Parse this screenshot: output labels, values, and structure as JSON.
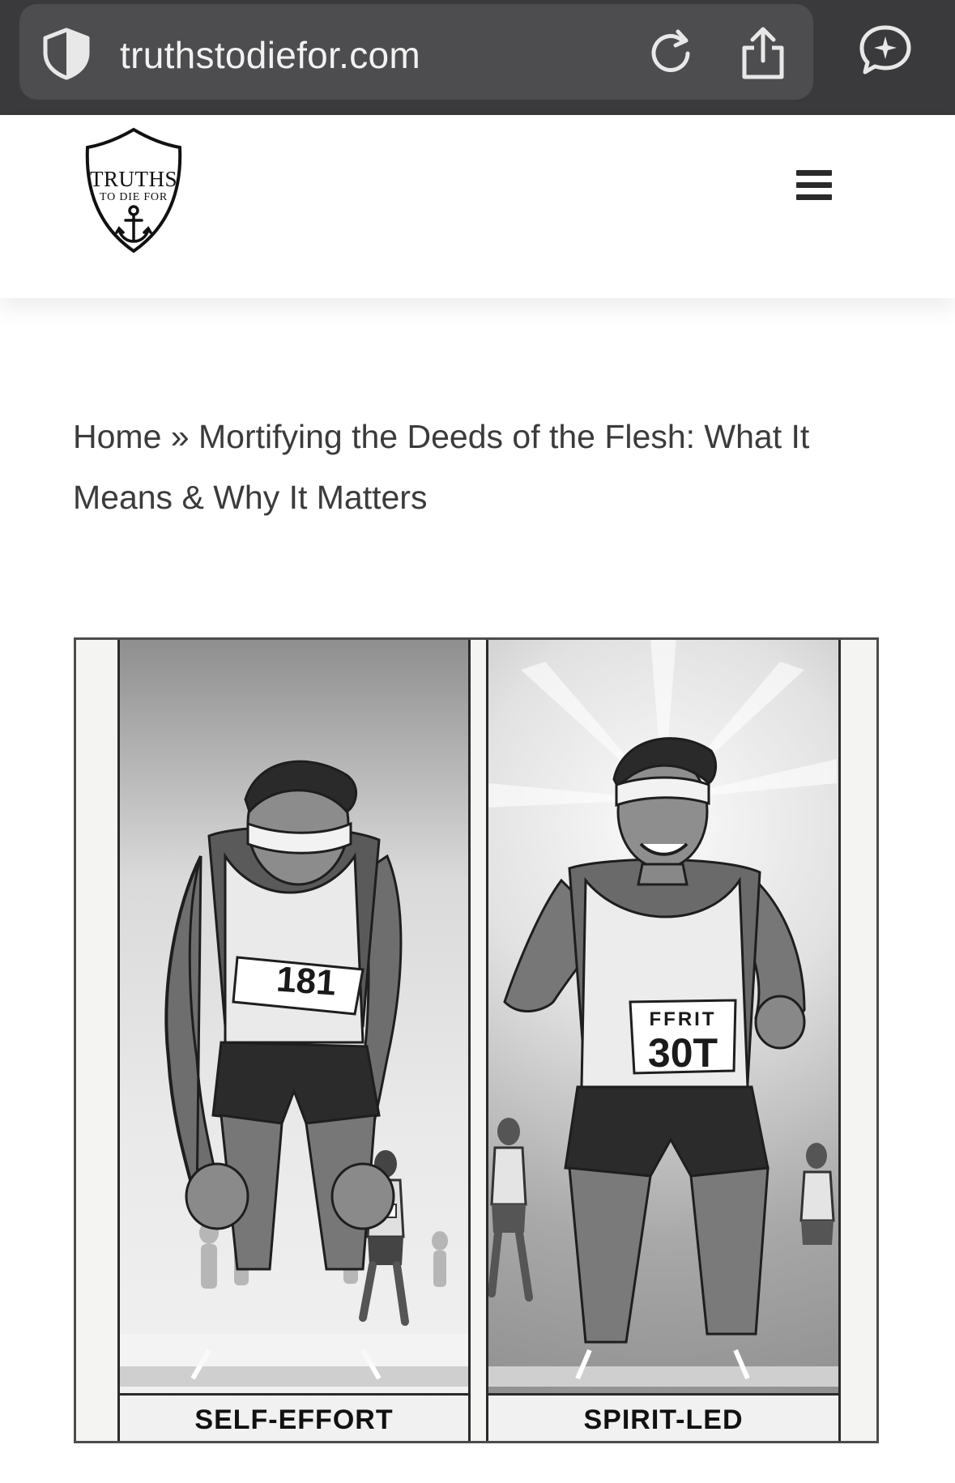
{
  "browser": {
    "url": "truthstodiefor.com",
    "icons": [
      "shield-icon",
      "reload-icon",
      "share-icon",
      "assistant-icon"
    ],
    "bar_color": "#3a3a3c"
  },
  "header": {
    "logo": {
      "line1": "TRUTHS",
      "line2": "TO DIE FOR"
    },
    "menu_icon": "hamburger-menu-icon"
  },
  "breadcrumb": {
    "home": "Home",
    "separator": "»",
    "current": "Mortifying the Deeds of the Flesh: What It Means & Why It Matters"
  },
  "featured_image": {
    "left_panel": {
      "caption": "SELF-EFFORT",
      "bib": "181"
    },
    "right_panel": {
      "caption": "SPIRIT-LED",
      "bib_top": "FFRIT",
      "bib_number": "30T"
    }
  }
}
